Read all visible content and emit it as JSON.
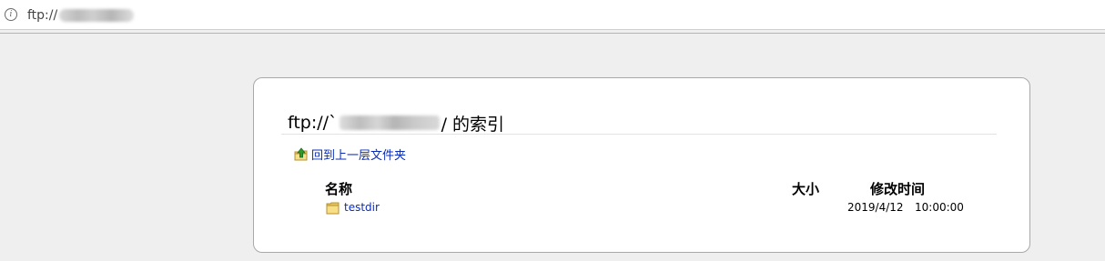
{
  "addressbar": {
    "info_icon": "info-icon",
    "info_glyph": "i",
    "url_prefix": "ftp://"
  },
  "listing": {
    "title_prefix": "ftp://`",
    "title_suffix": "/ 的索引",
    "up_link": {
      "icon": "up-folder-icon",
      "label": "回到上一层文件夹"
    },
    "columns": {
      "name": "名称",
      "size": "大小",
      "modified": "修改时间"
    },
    "entries": [
      {
        "icon": "folder-icon",
        "name": "testdir",
        "size": "",
        "date": "2019/4/12",
        "time": "10:00:00"
      }
    ]
  },
  "colors": {
    "page_background": "#efefef",
    "link": "#0b2db3",
    "panel_border": "#a9a9a9"
  }
}
